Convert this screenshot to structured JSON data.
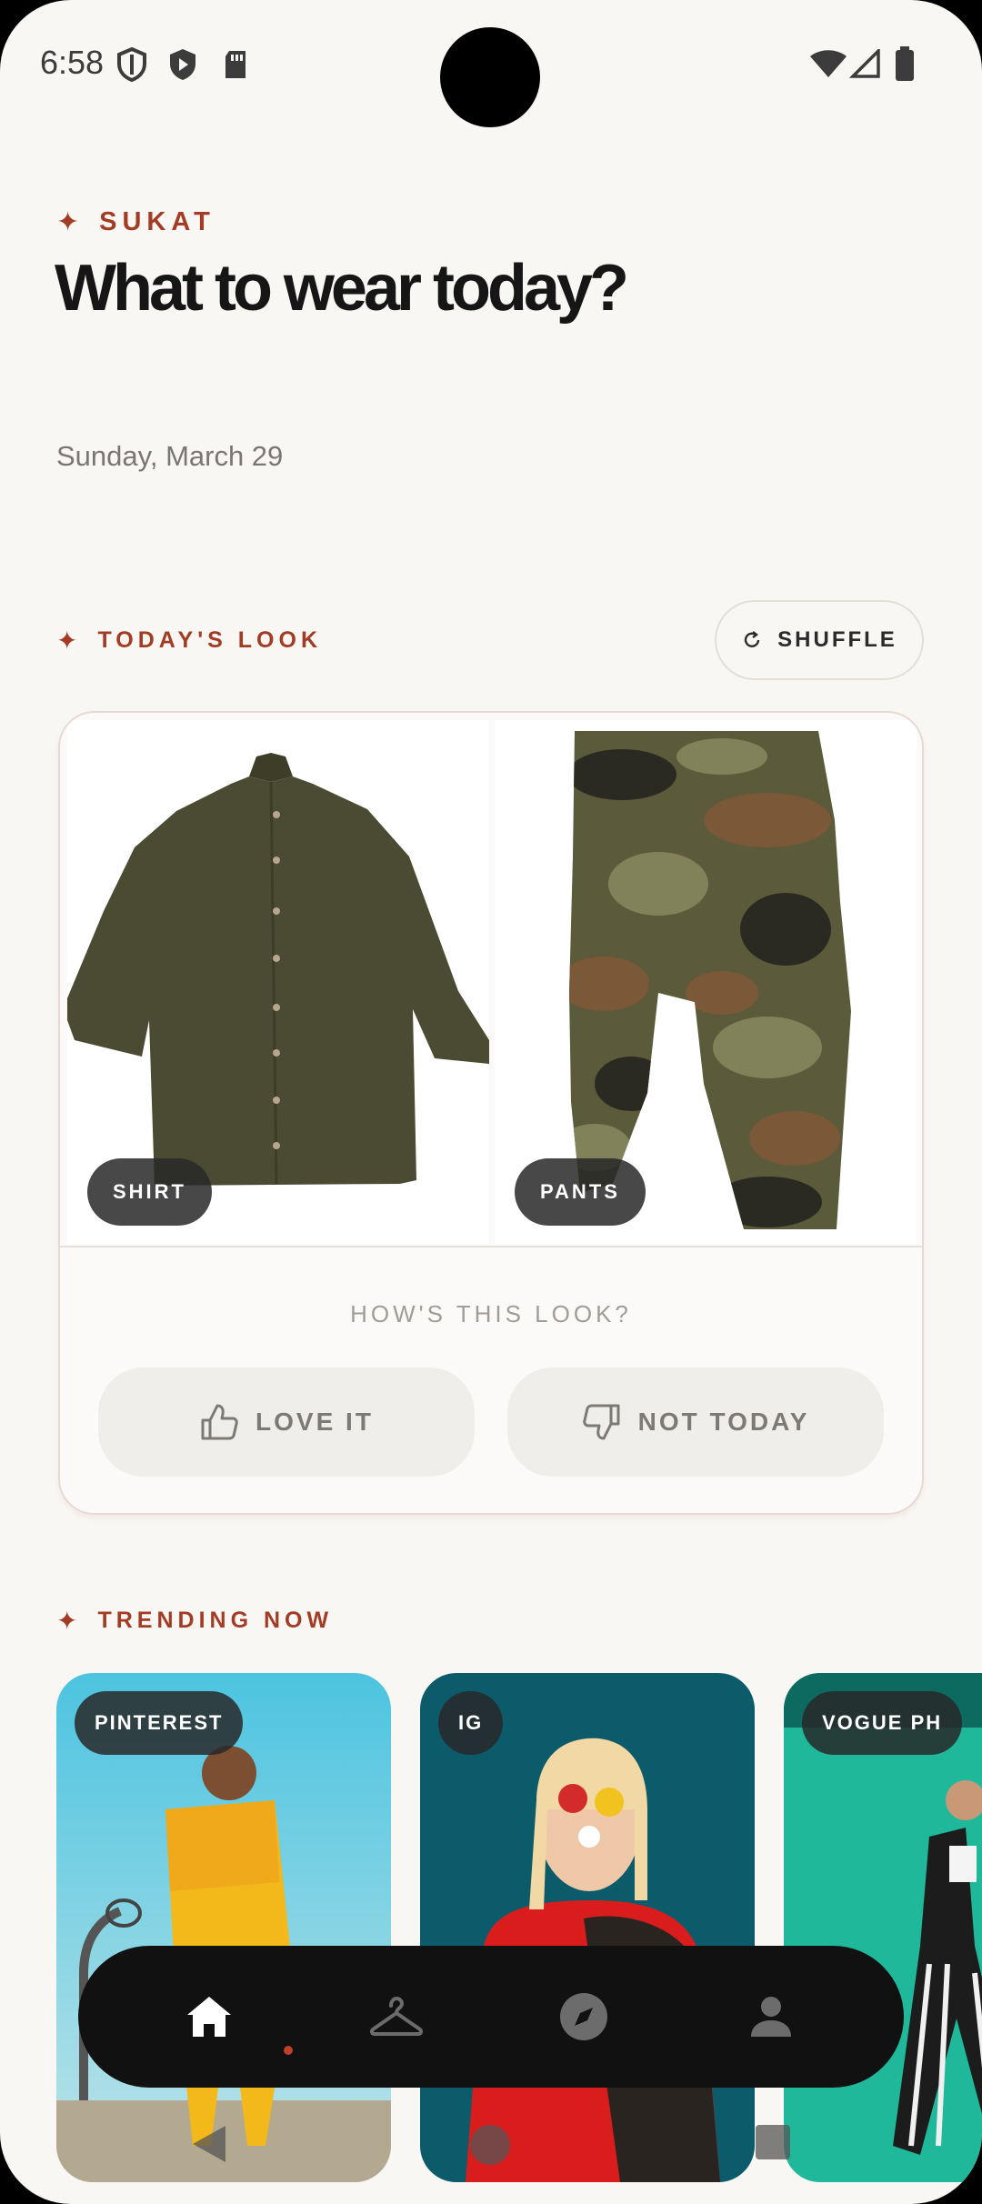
{
  "status_bar": {
    "time": "6:58"
  },
  "header": {
    "brand": "SUKAT",
    "headline": "What to wear today?",
    "date": "Sunday, March 29"
  },
  "todays_look": {
    "section_label": "TODAY'S LOOK",
    "shuffle_label": "SHUFFLE",
    "items": [
      {
        "tag": "SHIRT",
        "color": "#4b4b33"
      },
      {
        "tag": "PANTS",
        "color": "#5b5a3a"
      }
    ],
    "question": "HOW'S THIS LOOK?",
    "love_label": "LOVE IT",
    "not_label": "NOT TODAY"
  },
  "trending": {
    "section_label": "TRENDING NOW",
    "cards": [
      {
        "tag": "PINTEREST"
      },
      {
        "tag": "IG"
      },
      {
        "tag": "VOGUE PH"
      }
    ]
  },
  "bottom_nav": {
    "items": [
      {
        "icon": "home-icon",
        "active": true
      },
      {
        "icon": "hanger-icon",
        "active": false
      },
      {
        "icon": "compass-icon",
        "active": false
      },
      {
        "icon": "profile-icon",
        "active": false
      }
    ]
  },
  "colors": {
    "accent": "#a23c24",
    "background": "#f9f7f4",
    "nav_bg": "#111111"
  }
}
